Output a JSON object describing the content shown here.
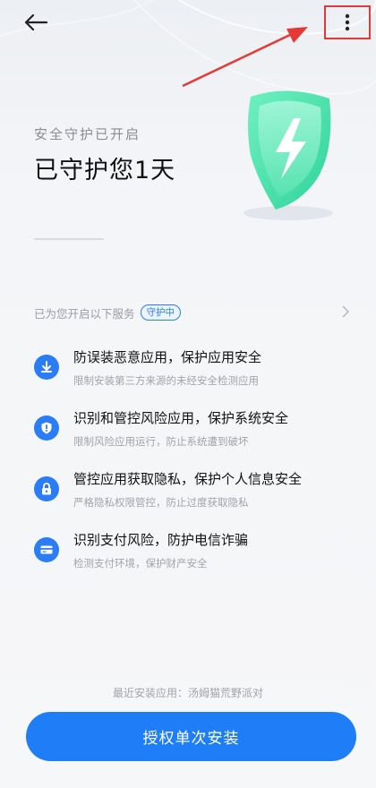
{
  "header": {
    "back_icon": "arrow-left-icon",
    "more_icon": "more-vertical-icon"
  },
  "status": {
    "subtitle": "安全守护已开启",
    "title": "已守护您1天",
    "shield_icon": "shield-lightning-icon",
    "shield_color": "#3fdca0"
  },
  "services": {
    "label": "已为您开启以下服务",
    "badge": "守护中",
    "chevron_icon": "chevron-right-icon",
    "items": [
      {
        "icon": "download-shield-icon",
        "title": "防误装恶意应用，保护应用安全",
        "desc": "限制安装第三方来源的未经安全检测应用"
      },
      {
        "icon": "shield-alert-icon",
        "title": "识别和管控风险应用，保护系统安全",
        "desc": "限制风险应用运行，防止系统遭到破坏"
      },
      {
        "icon": "lock-icon",
        "title": "管控应用获取隐私，保护个人信息安全",
        "desc": "严格隐私权限管控，防止过度获取隐私"
      },
      {
        "icon": "card-icon",
        "title": "识别支付风险，防护电信诈骗",
        "desc": "检测支付环境，保护财产安全"
      }
    ]
  },
  "footer": {
    "recent_app": "最近安装应用：汤姆猫荒野派对",
    "install_label": "授权单次安装"
  },
  "colors": {
    "accent": "#1f7ef7",
    "annotation": "#e53935"
  }
}
